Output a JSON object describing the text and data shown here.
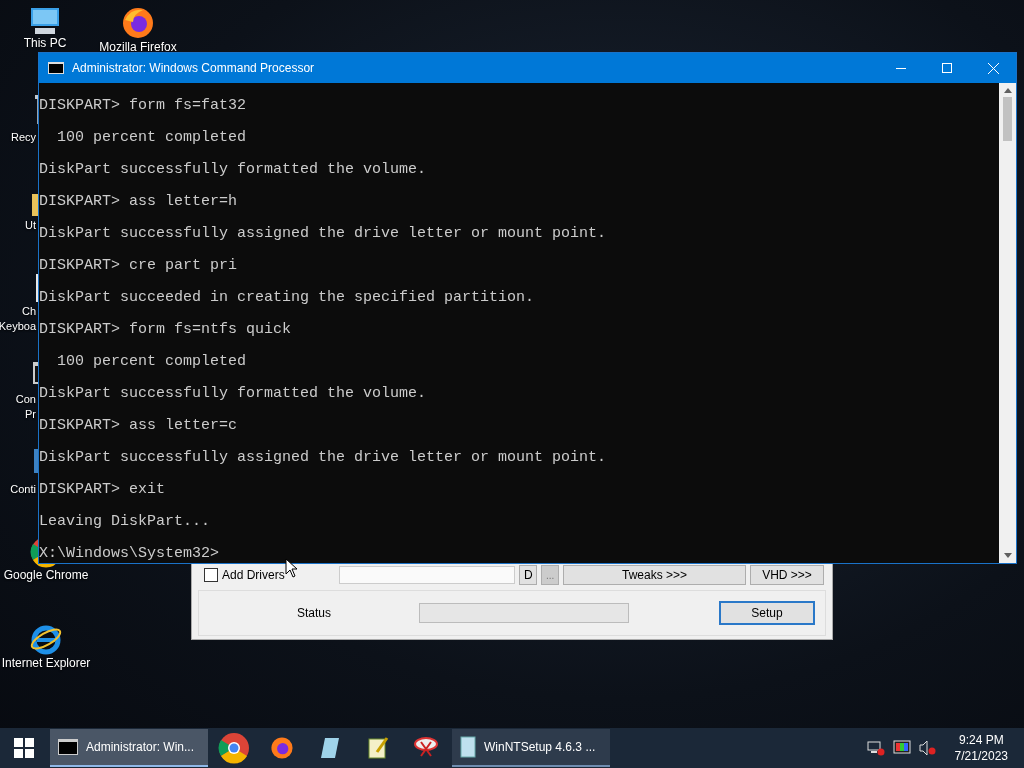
{
  "desktop_icons": [
    {
      "label": "This PC",
      "kind": "pc"
    },
    {
      "label": "Mozilla Firefox",
      "kind": "firefox"
    },
    {
      "label": "Recy",
      "kind": "bin"
    },
    {
      "label": "Ut",
      "kind": "folder"
    },
    {
      "label": "Ch\nKeyboa",
      "kind": "doc"
    },
    {
      "label": "Con\nPr",
      "kind": "cmd"
    },
    {
      "label": "Conti",
      "kind": "panel"
    },
    {
      "label": "Google Chrome",
      "kind": "chrome"
    },
    {
      "label": "Internet Explorer",
      "kind": "ie"
    }
  ],
  "setup_window": {
    "add_drivers": {
      "label": "Add Drivers",
      "checked": false
    },
    "d_button": "D",
    "browse_button": "...",
    "tweaks_button": "Tweaks >>>",
    "vhd_button": "VHD >>>",
    "status_label": "Status",
    "progress": {
      "level": 0
    },
    "setup_button": "Setup"
  },
  "cmd_window": {
    "title": "Administrator: Windows Command Processor",
    "lines": [
      "DISKPART> form fs=fat32",
      "  100 percent completed",
      "DiskPart successfully formatted the volume.",
      "DISKPART> ass letter=h",
      "DiskPart successfully assigned the drive letter or mount point.",
      "DISKPART> cre part pri",
      "DiskPart succeeded in creating the specified partition.",
      "DISKPART> form fs=ntfs quick",
      "  100 percent completed",
      "DiskPart successfully formatted the volume.",
      "DISKPART> ass letter=c",
      "DiskPart successfully assigned the drive letter or mount point.",
      "DISKPART> exit",
      "Leaving DiskPart...",
      "X:\\Windows\\System32>"
    ]
  },
  "taskbar": {
    "items": [
      {
        "kind": "window",
        "label": "Administrator: Win...",
        "selected": true
      },
      {
        "kind": "pin"
      },
      {
        "kind": "pin"
      },
      {
        "kind": "pin"
      },
      {
        "kind": "pin"
      },
      {
        "kind": "pin"
      },
      {
        "kind": "window",
        "label": "WinNTSetup 4.6.3   ...",
        "selected": false
      }
    ],
    "time": "9:24 PM",
    "date": "7/21/2023"
  }
}
